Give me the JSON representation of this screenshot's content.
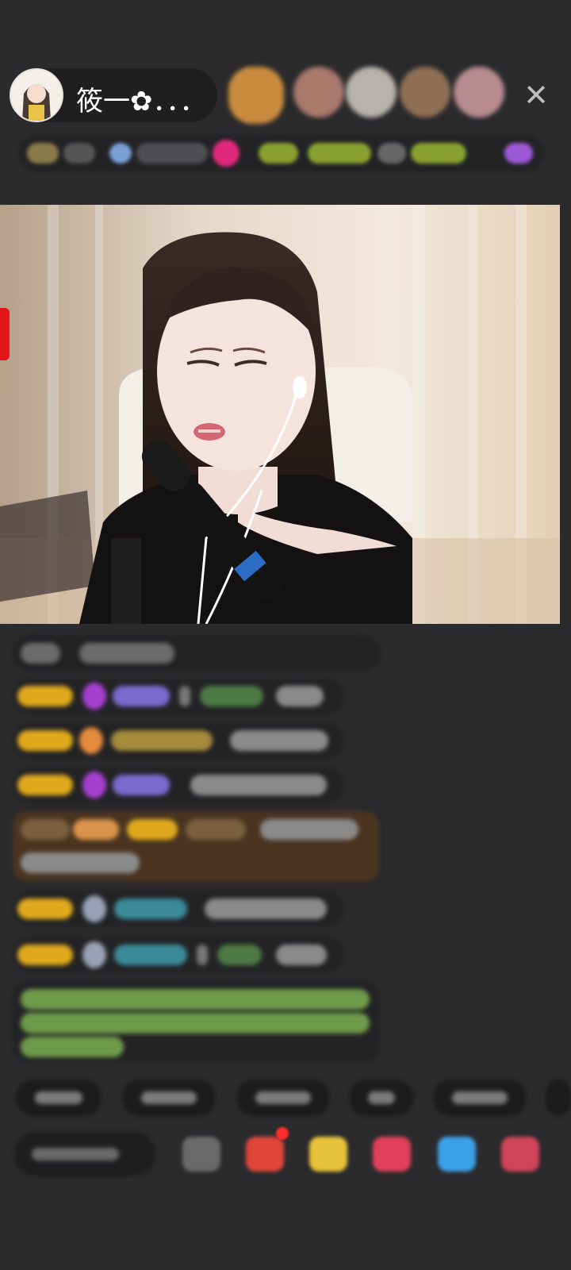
{
  "host": {
    "name": "筱一✿．．．"
  },
  "header": {
    "close_label": "✕"
  }
}
